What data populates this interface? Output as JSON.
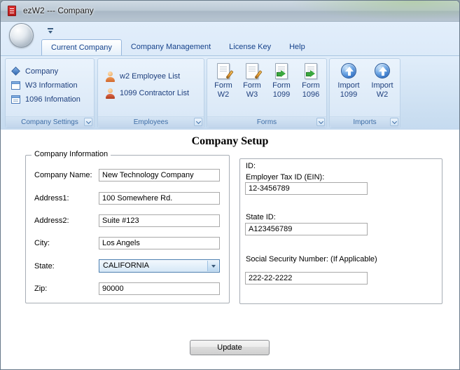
{
  "window": {
    "title": "ezW2 --- Company"
  },
  "ribbon": {
    "tabs": [
      {
        "label": "Current Company"
      },
      {
        "label": "Company Management"
      },
      {
        "label": "License Key"
      },
      {
        "label": "Help"
      }
    ],
    "groups": {
      "company_settings": {
        "label": "Company Settings",
        "items": [
          {
            "label": "Company"
          },
          {
            "label": "W3 Information"
          },
          {
            "label": "1096 Infomation"
          }
        ]
      },
      "employees": {
        "label": "Employees",
        "items": [
          {
            "label": "w2 Employee List"
          },
          {
            "label": "1099 Contractor List"
          }
        ]
      },
      "forms": {
        "label": "Forms",
        "items": [
          {
            "line1": "Form",
            "line2": "W2"
          },
          {
            "line1": "Form",
            "line2": "W3"
          },
          {
            "line1": "Form",
            "line2": "1099"
          },
          {
            "line1": "Form",
            "line2": "1096"
          }
        ]
      },
      "imports": {
        "label": "Imports",
        "items": [
          {
            "line1": "Import",
            "line2": "1099"
          },
          {
            "line1": "Import",
            "line2": "W2"
          }
        ]
      }
    }
  },
  "main": {
    "title": "Company Setup",
    "company_info": {
      "legend": "Company Information",
      "company_name": {
        "label": "Company Name:",
        "value": "New Technology Company"
      },
      "address1": {
        "label": "Address1:",
        "value": "100 Somewhere Rd."
      },
      "address2": {
        "label": "Address2:",
        "value": "Suite #123"
      },
      "city": {
        "label": "City:",
        "value": "Los Angels"
      },
      "state": {
        "label": "State:",
        "value": "CALIFORNIA"
      },
      "zip": {
        "label": "Zip:",
        "value": "90000"
      }
    },
    "ids": {
      "heading": "ID:",
      "ein": {
        "label": "Employer Tax ID (EIN):",
        "value": "12-3456789"
      },
      "state_id": {
        "label": "State ID:",
        "value": "A123456789"
      },
      "ssn": {
        "label": "Social Security Number: (If Applicable)",
        "value": "222-22-2222"
      }
    },
    "update_label": "Update"
  },
  "colors": {
    "accent_blue": "#15428b",
    "ribbon_bg": "#d9e7f6",
    "app_icon_red": "#c82020"
  }
}
